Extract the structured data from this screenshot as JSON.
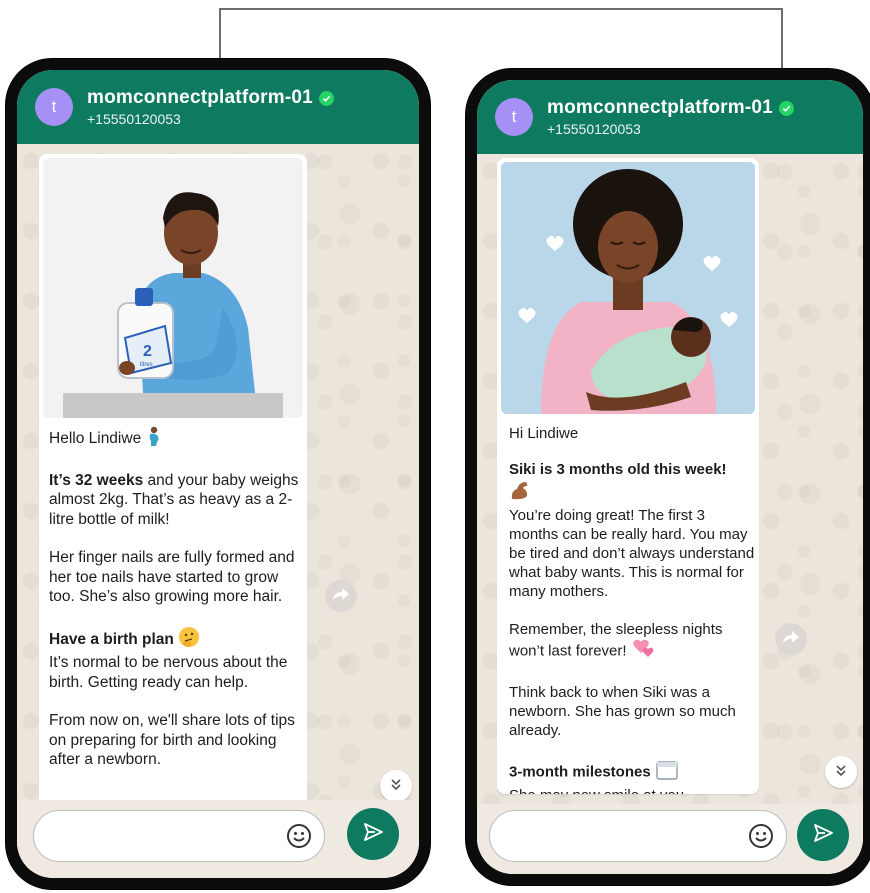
{
  "colors": {
    "header": "#0e7a5f",
    "send_button": "#0e7a5f",
    "avatar": "#a68ff5",
    "verified": "#25d366",
    "chat_bg": "#ece5dc"
  },
  "phones": [
    {
      "contact": {
        "avatar_letter": "t",
        "name": "momconnectplatform-01",
        "phone": "+15550120053"
      },
      "message": {
        "greeting": "Hello Lindiwe",
        "p1_bold": "It’s 32 weeks",
        "p1_rest": " and your baby weighs almost 2kg. That’s as heavy as a 2-litre bottle of milk!",
        "p2": "Her finger nails are fully formed and her toe nails have started to grow too. She’s also growing more hair.",
        "heading": "Have a birth plan",
        "p3": "It’s normal to be nervous about the birth. Getting ready can help.",
        "p4": "From now on, we'll share lots of tips on preparing for birth and looking after a newborn."
      },
      "illustration_label": "2",
      "illustration_sublabel": "litres",
      "composer": {
        "placeholder": ""
      }
    },
    {
      "contact": {
        "avatar_letter": "t",
        "name": "momconnectplatform-01",
        "phone": "+15550120053"
      },
      "message": {
        "greeting": "Hi Lindiwe",
        "heading1": "Siki  is 3 months old this week!",
        "p1": "You’re doing great! The first 3 months can be really hard. You may be tired and don’t always understand what baby wants. This is normal for many mothers.",
        "p2": "Remember, the sleepless nights won’t last forever!",
        "p3": "Think back to when Siki was a newborn. She has grown so much already.",
        "heading2": "3-month milestones",
        "p4": "She may now smile at you"
      },
      "composer": {
        "placeholder": ""
      }
    }
  ],
  "icons": {
    "verified": "verified-check-icon",
    "forward": "forward-icon",
    "scroll_down": "double-chevron-down-icon",
    "emoji": "smiley-icon",
    "send": "send-icon"
  }
}
